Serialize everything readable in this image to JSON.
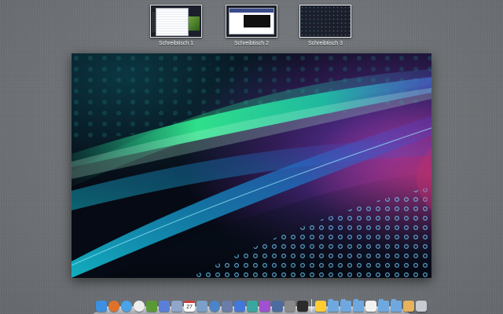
{
  "mission_control": {
    "spaces": [
      {
        "label": "Schreibtisch 1",
        "selected": false
      },
      {
        "label": "Schreibtisch 2",
        "selected": false
      },
      {
        "label": "Schreibtisch 3",
        "selected": true
      }
    ],
    "calendar_icon_day": "27"
  },
  "colors": {
    "background": "#6f7377",
    "wallpaper_green": "#2fe08a",
    "wallpaper_purple": "#7a3cc8",
    "wallpaper_magenta": "#c0306e",
    "wallpaper_blue": "#3a8ee8",
    "wallpaper_dark": "#060a14"
  },
  "dock": {
    "items": [
      {
        "icon": "finder-icon",
        "color": "#3d8fe0"
      },
      {
        "icon": "firefox-icon",
        "color": "#e0712a"
      },
      {
        "icon": "safari-icon",
        "color": "#4aa3e8"
      },
      {
        "icon": "ical-dot-icon",
        "color": "#ececec"
      },
      {
        "icon": "minecraft-icon",
        "color": "#5a9a34"
      },
      {
        "icon": "itunes-icon",
        "color": "#5a7fd9"
      },
      {
        "icon": "preview-icon",
        "color": "#8fa6c8"
      },
      {
        "icon": "calendar-icon",
        "color": "#ffffff"
      },
      {
        "icon": "mail-icon",
        "color": "#7b9fc7"
      },
      {
        "icon": "network-icon",
        "color": "#4c84c9"
      },
      {
        "icon": "tools-icon",
        "color": "#6a7da6"
      },
      {
        "icon": "app-store-icon",
        "color": "#4478d8"
      },
      {
        "icon": "pen-icon",
        "color": "#3aa6a0"
      },
      {
        "icon": "gradient-icon",
        "color": "#a050d0"
      },
      {
        "icon": "photo-icon",
        "color": "#4c6ca0"
      },
      {
        "icon": "preferences-icon",
        "color": "#8a8a8a"
      },
      {
        "icon": "terminal-icon",
        "color": "#2b2b2b"
      },
      {
        "icon": "xcode-icon",
        "color": "#ffcc33"
      },
      {
        "icon": "folder-icon",
        "color": "#6fa8df"
      },
      {
        "icon": "folder-icon",
        "color": "#6fa8df"
      },
      {
        "icon": "folder-icon",
        "color": "#6fa8df"
      },
      {
        "icon": "document-icon",
        "color": "#f2f2f2"
      },
      {
        "icon": "folder-icon",
        "color": "#6fa8df"
      },
      {
        "icon": "folder-icon",
        "color": "#6fa8df"
      },
      {
        "icon": "home-folder-icon",
        "color": "#e6b25c"
      },
      {
        "icon": "trash-icon",
        "color": "#c8ccd2"
      }
    ]
  }
}
